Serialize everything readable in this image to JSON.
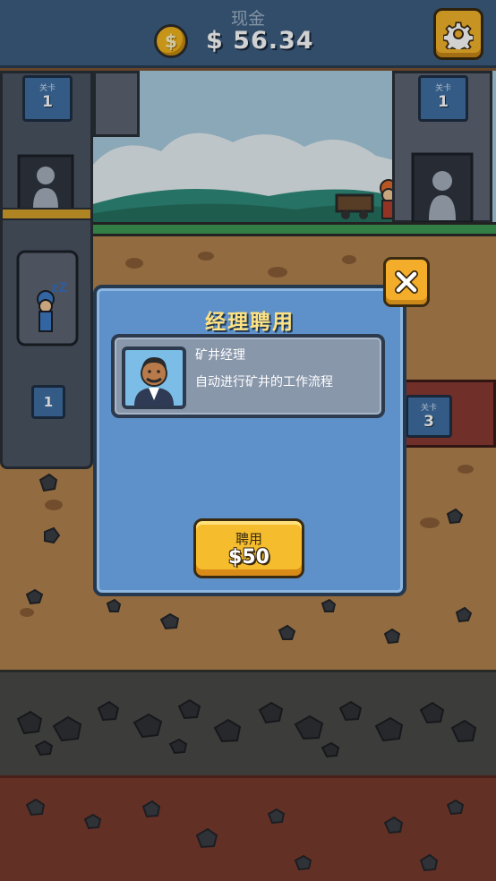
{
  "header": {
    "cash_label": "现金",
    "coin_symbol": "$",
    "cash_value": "$ 56.34",
    "settings_icon": "gear-icon"
  },
  "scene": {
    "elevator_level_label": "关卡",
    "elevator_level_number": "1",
    "elevator_small_level": "1",
    "warehouse_level_label": "关卡",
    "warehouse_level_number": "1",
    "shaft3_level_label": "关卡",
    "shaft3_level_number": "3",
    "sleep_icon": "zzz-icon",
    "colors": {
      "sky": "#a9cde0",
      "grass": "#3f9a55",
      "dirt": "#b2844f",
      "rock": "#4a4a47",
      "clay": "#793b2e"
    }
  },
  "modal": {
    "title": "经理聘用",
    "close_icon": "close-icon",
    "card": {
      "title": "矿井经理",
      "description": "自动进行矿井的工作流程",
      "portrait_icon": "manager-portrait-icon"
    },
    "hire_button": {
      "label": "聘用",
      "price": "$50"
    }
  }
}
